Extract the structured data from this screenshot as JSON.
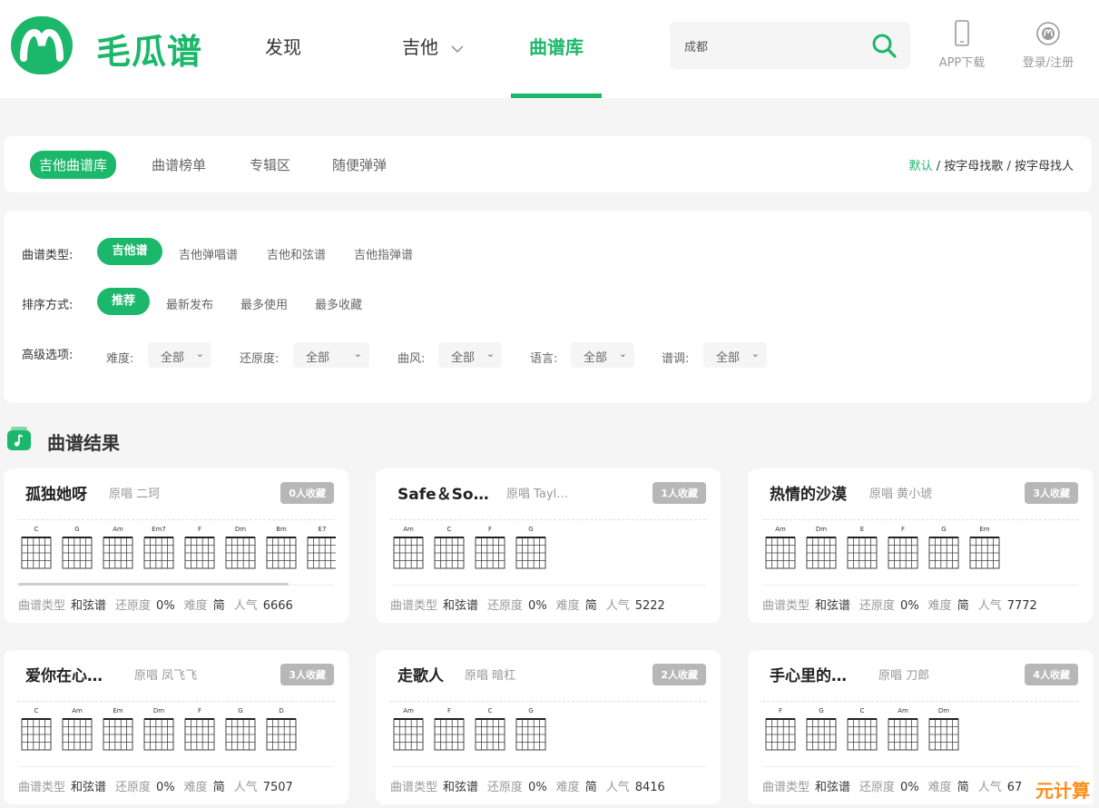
{
  "brand": {
    "name": "毛瓜谱",
    "color": "#1bb76a"
  },
  "nav": {
    "discover": "发现",
    "guitar": "吉他",
    "library": "曲谱库"
  },
  "search": {
    "value": "成都"
  },
  "header_actions": {
    "app_download": "APP下载",
    "login": "登录/注册"
  },
  "tabs": {
    "items": [
      "吉他曲谱库",
      "曲谱榜单",
      "专辑区",
      "随便弹弹"
    ],
    "active": 0
  },
  "sort_links": {
    "default": "默认",
    "by_song_letter": "按字母找歌",
    "by_artist_letter": "按字母找人",
    "separator": "/"
  },
  "filters": {
    "type": {
      "label": "曲谱类型:",
      "options": [
        "吉他谱",
        "吉他弹唱谱",
        "吉他和弦谱",
        "吉他指弹谱"
      ],
      "active": 0
    },
    "sort": {
      "label": "排序方式:",
      "options": [
        "推荐",
        "最新发布",
        "最多使用",
        "最多收藏"
      ],
      "active": 0
    },
    "advanced": {
      "label": "高级选项:",
      "fields": [
        {
          "label": "难度:",
          "value": "全部"
        },
        {
          "label": "还原度:",
          "value": "全部"
        },
        {
          "label": "曲风:",
          "value": "全部"
        },
        {
          "label": "语言:",
          "value": "全部"
        },
        {
          "label": "谱调:",
          "value": "全部"
        }
      ]
    }
  },
  "results": {
    "title": "曲谱结果"
  },
  "card_labels": {
    "type": "曲谱类型",
    "restore": "还原度",
    "difficulty": "难度",
    "popularity": "人气"
  },
  "cards": [
    {
      "title": "孤独她呀",
      "singer": "原唱 二珂",
      "favorites": "0人收藏",
      "type": "和弦谱",
      "restore": "0%",
      "difficulty": "简",
      "popularity": "6666",
      "chords": [
        "C",
        "G",
        "Am",
        "Em7",
        "F",
        "Dm",
        "Bm",
        "E7"
      ],
      "scroll": true
    },
    {
      "title": "Safe＆So…",
      "singer": "原唱 Tayl…",
      "favorites": "1人收藏",
      "type": "和弦谱",
      "restore": "0%",
      "difficulty": "简",
      "popularity": "5222",
      "chords": [
        "Am",
        "C",
        "F",
        "G"
      ],
      "scroll": false
    },
    {
      "title": "热情的沙漠",
      "singer": "原唱 黄小琥",
      "favorites": "3人收藏",
      "type": "和弦谱",
      "restore": "0%",
      "difficulty": "简",
      "popularity": "7772",
      "chords": [
        "Am",
        "Dm",
        "E",
        "F",
        "G",
        "Em"
      ],
      "scroll": false
    },
    {
      "title": "爱你在心…",
      "singer": "原唱 凤飞飞",
      "favorites": "3人收藏",
      "type": "和弦谱",
      "restore": "0%",
      "difficulty": "简",
      "popularity": "7507",
      "chords": [
        "C",
        "Am",
        "Em",
        "Dm",
        "F",
        "G",
        "D"
      ],
      "scroll": false
    },
    {
      "title": "走歌人",
      "singer": "原唱 暗杠",
      "favorites": "2人收藏",
      "type": "和弦谱",
      "restore": "0%",
      "difficulty": "简",
      "popularity": "8416",
      "chords": [
        "Am",
        "F",
        "C",
        "G"
      ],
      "scroll": false
    },
    {
      "title": "手心里的…",
      "singer": "原唱 刀郎",
      "favorites": "4人收藏",
      "type": "和弦谱",
      "restore": "0%",
      "difficulty": "简",
      "popularity": "67",
      "chords": [
        "F",
        "G",
        "C",
        "Am",
        "Dm"
      ],
      "scroll": false
    }
  ],
  "watermark": "元计算"
}
